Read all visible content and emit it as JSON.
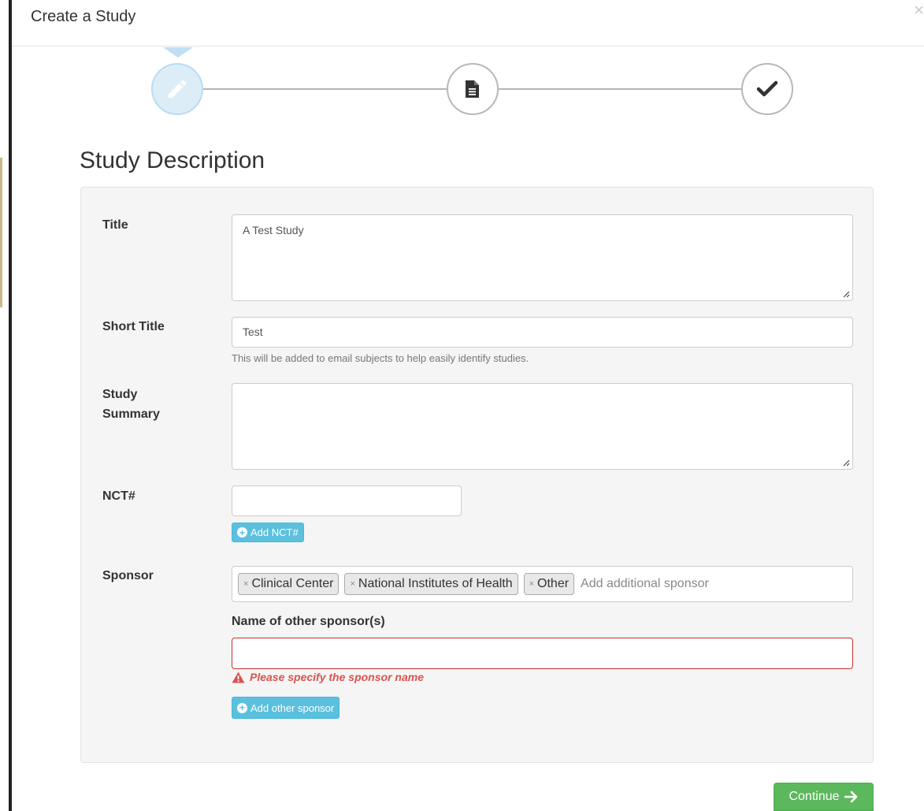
{
  "modal": {
    "title": "Create a Study",
    "close_label": "×"
  },
  "stepper": {
    "steps": [
      {
        "icon": "pencil-icon",
        "state": "active"
      },
      {
        "icon": "document-icon",
        "state": "pending"
      },
      {
        "icon": "checkmark-icon",
        "state": "pending"
      }
    ]
  },
  "section_title": "Study Description",
  "form": {
    "title": {
      "label": "Title",
      "value": "A Test Study"
    },
    "short_title": {
      "label": "Short Title",
      "value": "Test",
      "help": "This will be added to email subjects to help easily identify studies."
    },
    "study_summary": {
      "label_line1": "Study",
      "label_line2": "Summary",
      "value": ""
    },
    "nct": {
      "label": "NCT#",
      "value": "",
      "add_button": "Add NCT#"
    },
    "sponsor": {
      "label": "Sponsor",
      "tags": [
        "Clinical Center",
        "National Institutes of Health",
        "Other"
      ],
      "tag_remove_label": "×",
      "placeholder": "Add additional sponsor"
    },
    "other_sponsor": {
      "label": "Name of other sponsor(s)",
      "value": "",
      "error": "Please specify the sponsor name",
      "add_button": "Add other sponsor"
    }
  },
  "footer": {
    "continue_label": "Continue"
  },
  "colors": {
    "info": "#5bc0de",
    "success": "#5cb85c",
    "danger": "#d9534f",
    "step_active": "#dcedf8"
  }
}
